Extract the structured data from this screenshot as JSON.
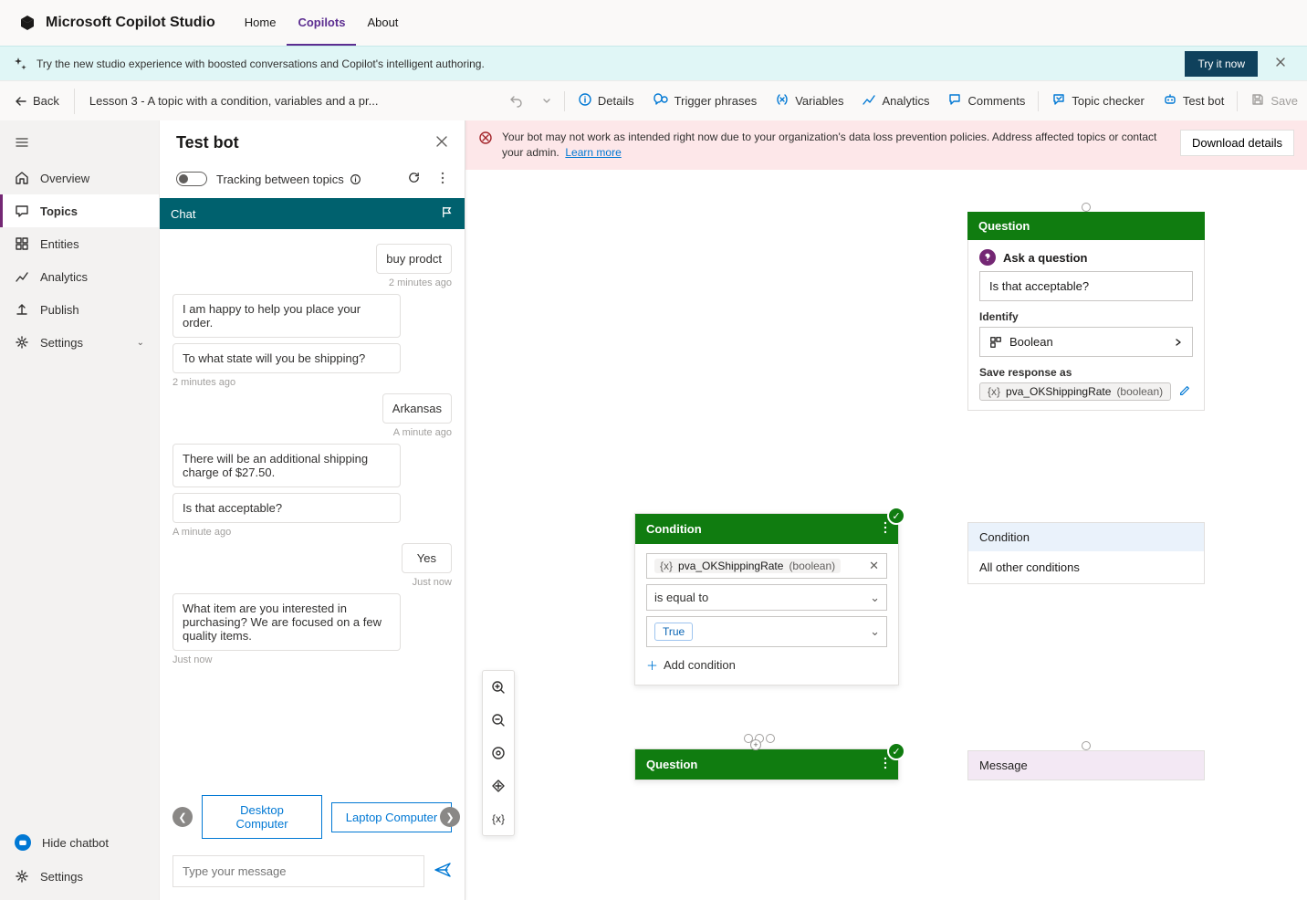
{
  "header": {
    "title": "Microsoft Copilot Studio",
    "nav": {
      "home": "Home",
      "copilots": "Copilots",
      "about": "About"
    }
  },
  "banner": {
    "text": "Try the new studio experience with boosted conversations and Copilot's intelligent authoring.",
    "button": "Try it now"
  },
  "subbar": {
    "back": "Back",
    "breadcrumb": "Lesson 3 - A topic with a condition, variables and a pr...",
    "buttons": {
      "details": "Details",
      "trigger": "Trigger phrases",
      "variables": "Variables",
      "analytics": "Analytics",
      "comments": "Comments",
      "topicChecker": "Topic checker",
      "testBot": "Test bot",
      "save": "Save"
    }
  },
  "sidebar": {
    "overview": "Overview",
    "topics": "Topics",
    "entities": "Entities",
    "analytics": "Analytics",
    "publish": "Publish",
    "settings": "Settings",
    "hideChatbot": "Hide chatbot",
    "footerSettings": "Settings"
  },
  "testbot": {
    "title": "Test bot",
    "toggleLabel": "Tracking between topics",
    "chatHeader": "Chat",
    "messages": {
      "m1": "buy prodct",
      "t1": "2 minutes ago",
      "m2": "I am happy to help you place your order.",
      "m3": "To what state will you be shipping?",
      "t3": "2 minutes ago",
      "m4": "Arkansas",
      "t4": "A minute ago",
      "m5": "There will be an additional shipping charge of $27.50.",
      "m6": "Is that acceptable?",
      "t6": "A minute ago",
      "m7": "Yes",
      "t7": "Just now",
      "m8": "What item are you interested in purchasing? We are focused on a few quality items.",
      "t8": "Just now"
    },
    "suggest": {
      "a": "Desktop Computer",
      "b": "Laptop Computer"
    },
    "placeholder": "Type your message"
  },
  "warn": {
    "text": "Your bot may not work as intended right now due to your organization's data loss prevention policies. Address affected topics or contact your admin.",
    "link": "Learn more",
    "download": "Download details"
  },
  "question": {
    "head": "Question",
    "askLabel": "Ask a question",
    "askValue": "Is that acceptable?",
    "identifyLabel": "Identify",
    "identifyValue": "Boolean",
    "saveLabel": "Save response as",
    "varName": "pva_OKShippingRate",
    "varType": "(boolean)"
  },
  "condition": {
    "head": "Condition",
    "varName": "pva_OKShippingRate",
    "varType": "(boolean)",
    "op": "is equal to",
    "val": "True",
    "add": "Add condition"
  },
  "condOther": {
    "head": "Condition",
    "sub": "All other conditions"
  },
  "question2": {
    "head": "Question"
  },
  "message": {
    "head": "Message"
  }
}
